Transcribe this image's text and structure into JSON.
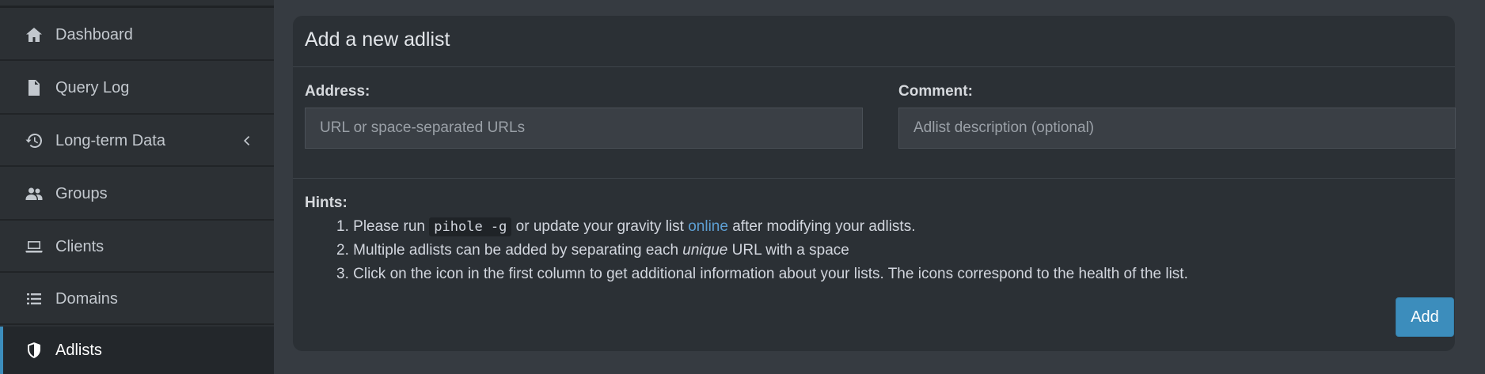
{
  "sidebar": {
    "items": [
      {
        "label": "Dashboard",
        "icon": "home-icon"
      },
      {
        "label": "Query Log",
        "icon": "file-icon"
      },
      {
        "label": "Long-term Data",
        "icon": "history-icon",
        "has_submenu": true
      },
      {
        "label": "Groups",
        "icon": "users-icon"
      },
      {
        "label": "Clients",
        "icon": "laptop-icon"
      },
      {
        "label": "Domains",
        "icon": "list-icon"
      },
      {
        "label": "Adlists",
        "icon": "shield-icon",
        "active": true
      }
    ]
  },
  "card": {
    "title": "Add a new adlist",
    "address_label": "Address:",
    "address_placeholder": "URL or space-separated URLs",
    "address_value": "",
    "comment_label": "Comment:",
    "comment_placeholder": "Adlist description (optional)",
    "comment_value": "",
    "hints_label": "Hints:",
    "hints": {
      "h1_num": "1.",
      "h1_a": "Please run",
      "h1_code": "pihole -g",
      "h1_b": "or update your gravity list",
      "h1_link": "online",
      "h1_c": "after modifying your adlists.",
      "h2_num": "2.",
      "h2_a": "Multiple adlists can be added by separating each",
      "h2_em": "unique",
      "h2_b": "URL with a space",
      "h3_num": "3.",
      "h3_a": "Click on the icon in the first column to get additional information about your lists. The icons correspond to the health of the list."
    },
    "add_label": "Add"
  },
  "colors": {
    "accent": "#3c8dbc",
    "link": "#5d9fd3",
    "sidebar_bg": "#2c3034",
    "card_bg": "#2b3035",
    "page_bg": "#363b41"
  }
}
